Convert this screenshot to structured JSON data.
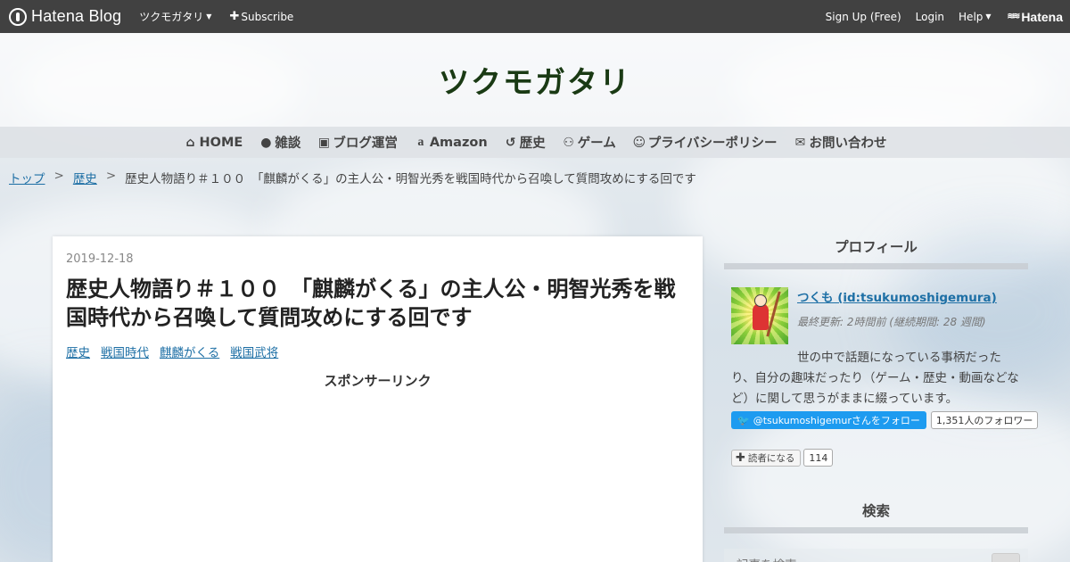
{
  "topbar": {
    "logo_text": "Hatena Blog",
    "blog_menu_label": "ツクモガタリ",
    "subscribe_label": "Subscribe",
    "signup_label": "Sign Up (Free)",
    "login_label": "Login",
    "help_label": "Help",
    "hatena_label": "Hatena"
  },
  "header": {
    "blog_title": "ツクモガタリ"
  },
  "nav": {
    "items": [
      {
        "label": "HOME",
        "icon": "home-icon"
      },
      {
        "label": "雑談",
        "icon": "chat-icon"
      },
      {
        "label": "ブログ運営",
        "icon": "blogger-icon"
      },
      {
        "label": "Amazon",
        "icon": "amazon-icon"
      },
      {
        "label": "歴史",
        "icon": "history-icon"
      },
      {
        "label": "ゲーム",
        "icon": "gamepad-icon"
      },
      {
        "label": "プライバシーポリシー",
        "icon": "smile-icon"
      },
      {
        "label": "お問い合わせ",
        "icon": "envelope-icon"
      }
    ]
  },
  "breadcrumb": {
    "top": "トップ",
    "sep": ">",
    "category": "歴史",
    "current": "歴史人物語り＃１００　「麒麟がくる」の主人公・明智光秀を戦国時代から召喚して質問攻めにする回です"
  },
  "article": {
    "date": "2019-12-18",
    "title": "歴史人物語り＃１００　「麒麟がくる」の主人公・明智光秀を戦国時代から召喚して質問攻めにする回です",
    "categories": [
      "歴史",
      "戦国時代",
      "麒麟がくる",
      "戦国武将"
    ],
    "sponsor_label": "スポンサーリンク"
  },
  "sidebar": {
    "profile_heading": "プロフィール",
    "profile_name": "つくも (id:tsukumoshigemura)",
    "profile_meta": "最終更新: 2時間前 (継続期間: 28 週間)",
    "profile_desc_line1": "世の中で話題になっている事柄だった",
    "profile_desc_rest": "り、自分の趣味だったり（ゲーム・歴史・動画などなど）に関して思うがままに綴っています。",
    "twitter_follow": "@tsukumoshigemurさんをフォロー",
    "follower_count": "1,351人のフォロワー",
    "reader_button": "読者になる",
    "reader_count": "114",
    "search_heading": "検索",
    "search_placeholder": "記事を検索"
  }
}
